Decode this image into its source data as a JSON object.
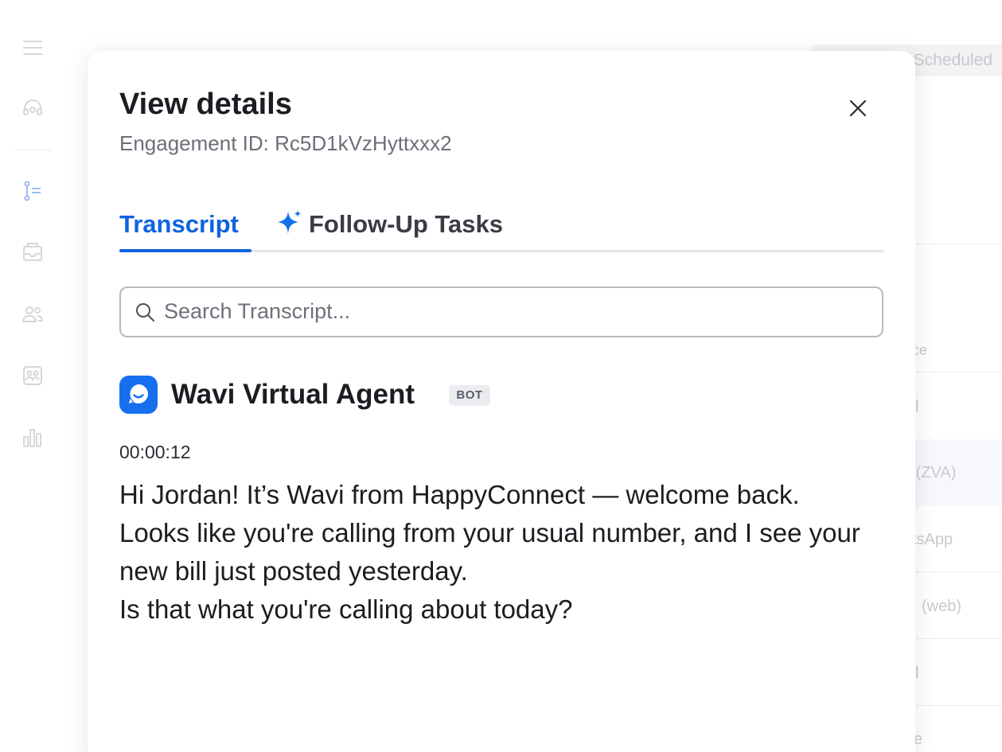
{
  "background": {
    "scheduled_tab": "Scheduled",
    "row_fragments": [
      "ce",
      "l",
      "e (ZVA)",
      "tsApp",
      "(web)",
      "l",
      "e"
    ]
  },
  "modal": {
    "title": "View details",
    "subtitle": "Engagement ID: Rc5D1kVzHyttxxx2",
    "tabs": [
      {
        "label": "Transcript",
        "active": true
      },
      {
        "label": "Follow-Up Tasks",
        "icon": "sparkle-icon",
        "active": false
      }
    ],
    "search": {
      "placeholder": "Search Transcript...",
      "value": ""
    },
    "message": {
      "sender": "Wavi Virtual Agent",
      "badge": "BOT",
      "timestamp": "00:00:12",
      "lines": [
        "Hi Jordan! It’s Wavi from HappyConnect — welcome back.",
        "Looks like you're calling from your usual number, and I see your new bill just posted yesterday.",
        "Is that what you're calling about today?"
      ]
    }
  },
  "colors": {
    "accent": "#0e63e0",
    "avatar": "#1670ee",
    "badge_bg": "#ebecf0"
  }
}
